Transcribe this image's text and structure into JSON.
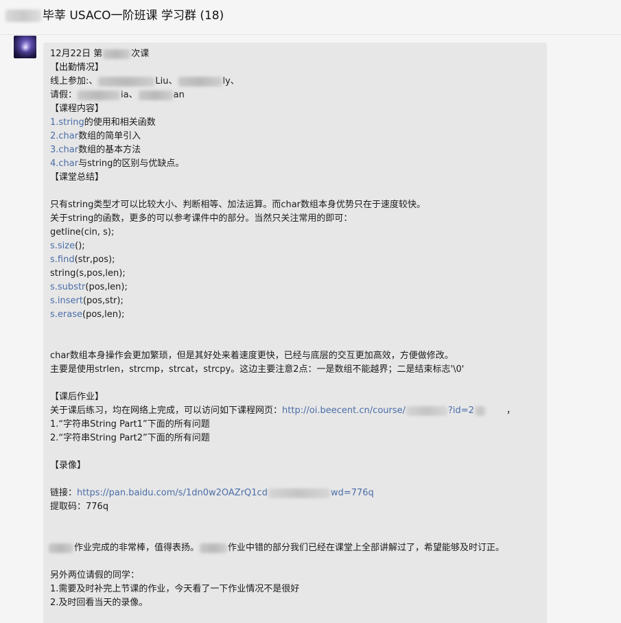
{
  "window": {
    "title": "毕莘 USACO一阶班课 学习群 (18)"
  },
  "message": {
    "l01_a": "12月22日 第",
    "l01_b": "次课",
    "l02": "【出勤情况】",
    "l03_a": "线上参加:、",
    "l03_b": "Liu、",
    "l03_c": "ly、",
    "l04_a": "请假：",
    "l04_b": "ia、",
    "l04_c": "an",
    "l05": "【课程内容】",
    "l06_num": "1.string",
    "l06_text": "的使用和相关函数",
    "l07_num": "2.char",
    "l07_text": "数组的简单引入",
    "l08_num": "3.char",
    "l08_text": "数组的基本方法",
    "l09_num": "4.char",
    "l09_text": "与string的区别与优缺点。",
    "l10": "【课堂总结】",
    "l12": "只有string类型才可以比较大小、判断相等、加法运算。而char数组本身优势只在于速度较快。",
    "l13": "关于string的函数，更多的可以参考课件中的部分。当然只关注常用的即可：",
    "l14": "getline(cin, s);",
    "l15_a": "s.size",
    "l15_b": "();",
    "l16_a": "s.find",
    "l16_b": "(str,pos);",
    "l17": "string(s,pos,len);",
    "l18_a": "s.substr",
    "l18_b": "(pos,len);",
    "l19_a": "s.insert",
    "l19_b": "(pos,str);",
    "l20_a": "s.erase",
    "l20_b": "(pos,len);",
    "l23": "char数组本身操作会更加繁琐，但是其好处来着速度更快，已经与底层的交互更加高效，方便做修改。",
    "l24": "主要是使用strlen，strcmp，strcat，strcpy。这边主要注意2点：一是数组不能越界；二是结束标志'\\0'",
    "l26": "【课后作业】",
    "l27_a": "关于课后练习，均在网络上完成，可以访问如下课程网页：",
    "l27_link_a": "http://oi.beecent.cn/course/",
    "l27_link_b": "?id=2",
    "l27_c": "，",
    "l28": "1.“字符串String Part1”下面的所有问题",
    "l29": "2.“字符串String Part2”下面的所有问题",
    "l31": "【录像】",
    "l33_a": "链接：",
    "l33_link_a": "https://pan.baidu.com/s/1dn0w2OAZrQ1cd",
    "l33_link_b": "wd=776q",
    "l34": "提取码：776q",
    "l37_a": "作业完成的非常棒，值得表扬。",
    "l37_b": "作业中错的部分我们已经在课堂上全部讲解过了，希望能够及时订正。",
    "l39": "另外两位请假的同学：",
    "l40": "1.需要及时补完上节课的作业，今天看了一下作业情况不是很好",
    "l41": "2.及时回看当天的录像。"
  },
  "colors": {
    "link": "#4a6da7",
    "bubble": "#e7e7e7",
    "background": "#f5f5f5"
  },
  "icons": {
    "avatar": "group-member-avatar"
  }
}
